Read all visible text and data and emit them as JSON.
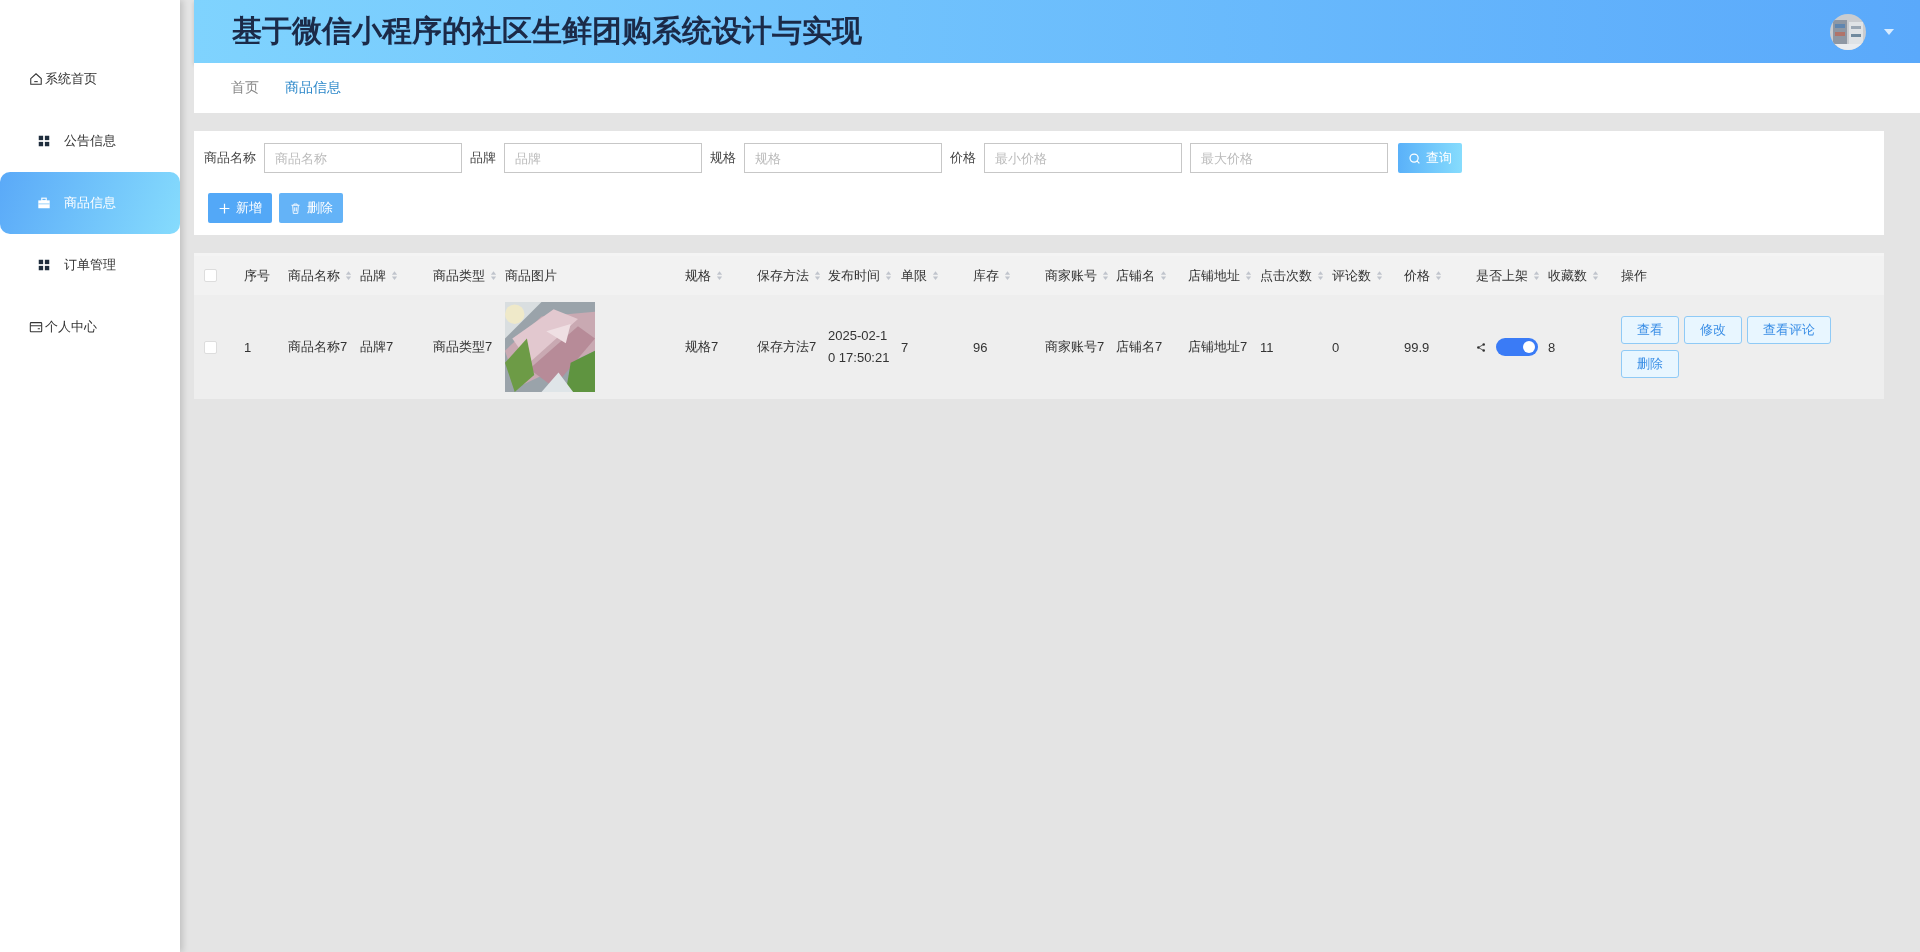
{
  "sidebar": {
    "items": [
      {
        "label": "系统首页",
        "selected": false
      },
      {
        "label": "公告信息",
        "selected": false
      },
      {
        "label": "商品信息",
        "selected": true
      },
      {
        "label": "订单管理",
        "selected": false
      },
      {
        "label": "个人中心",
        "selected": false
      }
    ]
  },
  "header": {
    "title": "基于微信小程序的社区生鲜团购系统设计与实现",
    "avatar": {
      "kind": "picture"
    }
  },
  "breadcrumb": [
    {
      "label": "首页",
      "selected": false
    },
    {
      "label": "商品信息",
      "selected": true
    }
  ],
  "search": {
    "fields": [
      {
        "label": "商品名称",
        "placeholder": "商品名称"
      },
      {
        "label": "品牌",
        "placeholder": "品牌"
      },
      {
        "label": "规格",
        "placeholder": "规格"
      },
      {
        "label": "价格",
        "placeholder": "最小价格"
      },
      {
        "placeholder": "最大价格"
      }
    ],
    "button": "查询"
  },
  "actions": [
    {
      "kind": "add",
      "label": "新增"
    },
    {
      "kind": "delete",
      "label": "删除"
    }
  ],
  "table": {
    "header_checked": false,
    "columns": [
      {
        "kind": "check"
      },
      {
        "label": "序号",
        "sortable": false
      },
      {
        "label": "商品名称",
        "sortable": true
      },
      {
        "label": "品牌",
        "sortable": true
      },
      {
        "label": "商品类型",
        "sortable": true
      },
      {
        "label": "商品图片",
        "sortable": false
      },
      {
        "label": "规格",
        "sortable": true
      },
      {
        "label": "保存方法",
        "sortable": true
      },
      {
        "label": "发布时间",
        "sortable": true
      },
      {
        "label": "单限",
        "sortable": true
      },
      {
        "label": "库存",
        "sortable": true
      },
      {
        "label": "商家账号",
        "sortable": true
      },
      {
        "label": "店铺名",
        "sortable": true
      },
      {
        "label": "店铺地址",
        "sortable": true
      },
      {
        "label": "点击次数",
        "sortable": true
      },
      {
        "label": "评论数",
        "sortable": true
      },
      {
        "label": "价格",
        "sortable": true
      },
      {
        "label": "是否上架",
        "sortable": true
      },
      {
        "label": "收藏数",
        "sortable": true
      },
      {
        "label": "操作",
        "sortable": false
      }
    ],
    "rows": [
      {
        "checked": false,
        "cells": [
          {
            "kind": "check"
          },
          {
            "kind": "text",
            "text": "1"
          },
          {
            "kind": "text",
            "text": "商品名称7"
          },
          {
            "kind": "text",
            "text": "品牌7"
          },
          {
            "kind": "text",
            "text": "商品类型7"
          },
          {
            "kind": "picture"
          },
          {
            "kind": "text",
            "text": "规格7"
          },
          {
            "kind": "text",
            "text": "保存方法7"
          },
          {
            "kind": "text",
            "text": "2025-02-10 17:50:21"
          },
          {
            "kind": "text",
            "text": "7"
          },
          {
            "kind": "text",
            "text": "96"
          },
          {
            "kind": "text",
            "text": "商家账号7"
          },
          {
            "kind": "text",
            "text": "店铺名7"
          },
          {
            "kind": "text",
            "text": "店铺地址7"
          },
          {
            "kind": "text",
            "text": "11"
          },
          {
            "kind": "text",
            "text": "0"
          },
          {
            "kind": "text",
            "text": "99.9"
          },
          {
            "kind": "switch",
            "on": true
          },
          {
            "kind": "text",
            "text": "8"
          },
          {
            "kind": "buttons",
            "buttons": [
              "查看",
              "修改",
              "查看评论",
              "删除"
            ]
          }
        ]
      }
    ]
  }
}
